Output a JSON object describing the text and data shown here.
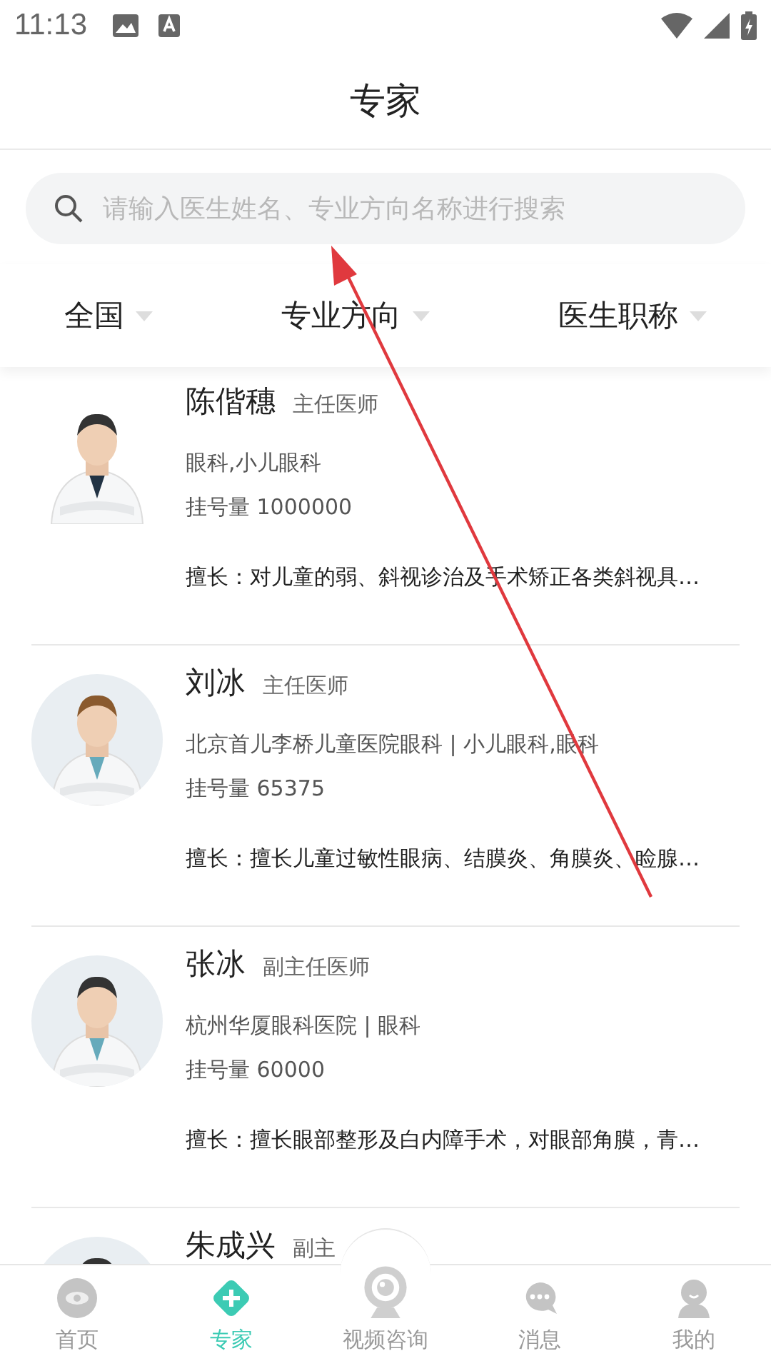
{
  "status_bar": {
    "time": "11:13"
  },
  "header": {
    "title": "专家"
  },
  "search": {
    "placeholder": "请输入医生姓名、专业方向名称进行搜索"
  },
  "filters": [
    {
      "label": "全国"
    },
    {
      "label": "专业方向"
    },
    {
      "label": "医生职称"
    }
  ],
  "doctors": [
    {
      "name": "陈偕穗",
      "title": "主任医师",
      "department": "眼科,小儿眼科",
      "registrations": "挂号量 1000000",
      "expertise": "擅长：对儿童的弱、斜视诊治及手术矫正各类斜视具…"
    },
    {
      "name": "刘冰",
      "title": "主任医师",
      "department": "北京首儿李桥儿童医院眼科 | 小儿眼科,眼科",
      "registrations": "挂号量 65375",
      "expertise": "擅长：擅长儿童过敏性眼病、结膜炎、角膜炎、睑腺…"
    },
    {
      "name": "张冰",
      "title": "副主任医师",
      "department": "杭州华厦眼科医院 | 眼科",
      "registrations": "挂号量 60000",
      "expertise": "擅长：擅长眼部整形及白内障手术，对眼部角膜，青…"
    },
    {
      "name": "朱成兴",
      "title": "副主"
    }
  ],
  "tab_bar": [
    {
      "label": "首页",
      "selected": false
    },
    {
      "label": "专家",
      "selected": true
    },
    {
      "label": "视频咨询",
      "selected": false
    },
    {
      "label": "消息",
      "selected": false
    },
    {
      "label": "我的",
      "selected": false
    }
  ]
}
